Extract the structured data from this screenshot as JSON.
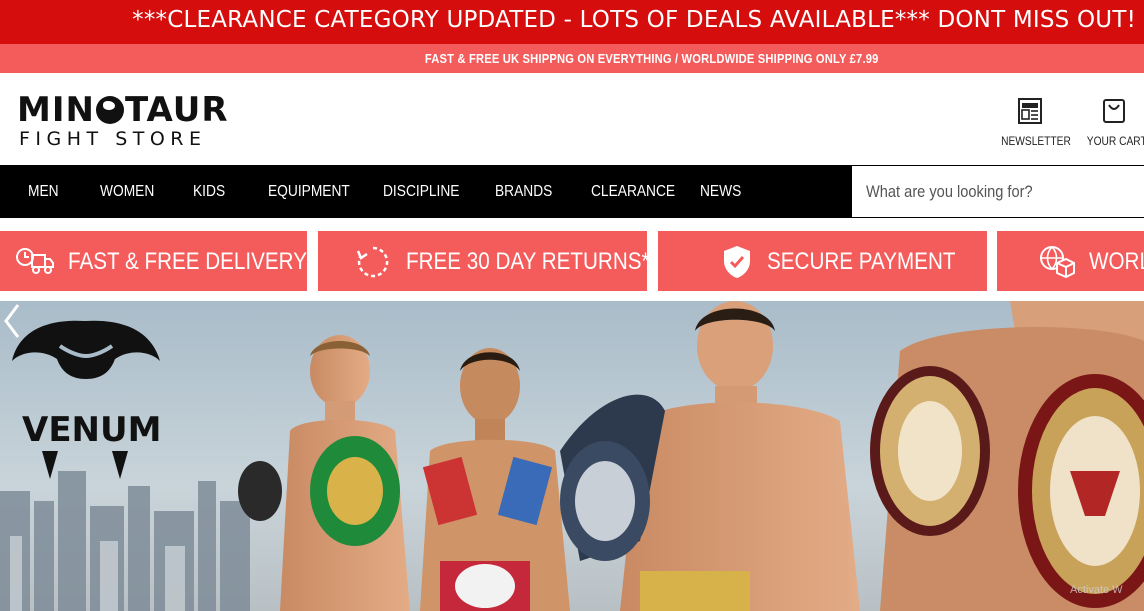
{
  "top_banner": {
    "text": "***CLEARANCE CATEGORY UPDATED - LOTS OF DEALS AVAILABLE*** DONT MISS OUT!"
  },
  "shipping_bar": {
    "text": "FAST & FREE UK SHIPPNG ON EVERYTHING / WORLDWIDE SHIPPING ONLY £7.99"
  },
  "logo": {
    "line1_pre": "MIN",
    "line1_post": "TAUR",
    "line2": "FIGHT STORE"
  },
  "header_actions": {
    "newsletter_label": "NEWSLETTER",
    "cart_label": "YOUR CART"
  },
  "nav": {
    "items": [
      "MEN",
      "WOMEN",
      "KIDS",
      "EQUIPMENT",
      "DISCIPLINE",
      "BRANDS",
      "CLEARANCE",
      "NEWS"
    ]
  },
  "search": {
    "placeholder": "What are you looking for?"
  },
  "features": [
    {
      "label": "FAST & FREE DELIVERY*",
      "icon": "delivery-truck-icon"
    },
    {
      "label": "FREE 30 DAY RETURNS*",
      "icon": "returns-arrows-icon"
    },
    {
      "label": "SECURE PAYMENT",
      "icon": "shield-check-icon"
    },
    {
      "label": "WORLDWIDE",
      "icon": "globe-box-icon"
    }
  ],
  "hero": {
    "brand_text": "VENUM",
    "watermark": "Activate W"
  },
  "colors": {
    "banner_red": "#d50d0d",
    "accent_coral": "#f45b5b",
    "nav_black": "#000000"
  }
}
